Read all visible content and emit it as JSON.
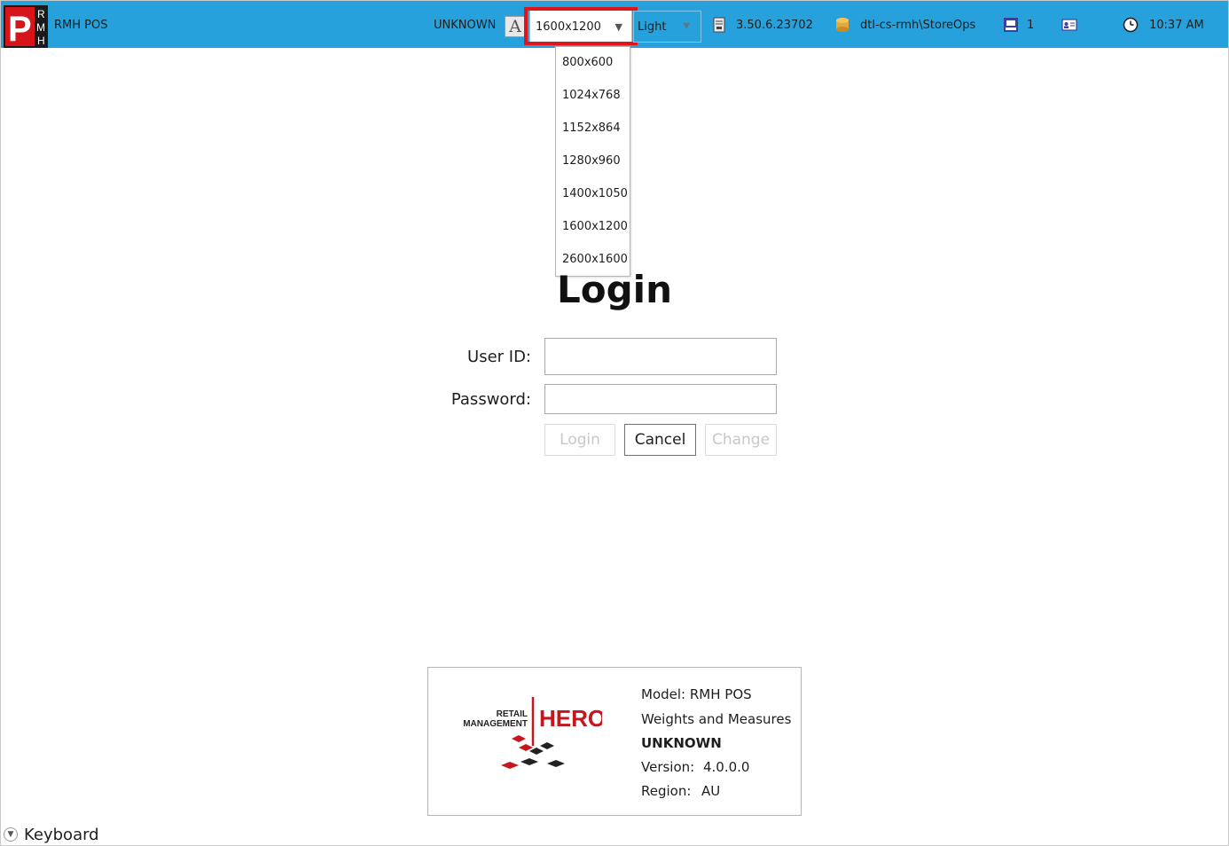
{
  "app": {
    "logo_letters": [
      "P",
      "R",
      "M",
      "H"
    ],
    "title": "RMH POS"
  },
  "topbar": {
    "user": "UNKNOWN",
    "font_icon": "A",
    "resolution_selected": "1600x1200",
    "theme_selected": "Light",
    "version": "3.50.6.23702",
    "database": "dtl-cs-rmh\\StoreOps",
    "register_count": "1",
    "time": "10:37 AM",
    "highlight_color": "#e0151b",
    "bar_color": "#27a1dc"
  },
  "resolution_options": [
    "800x600",
    "1024x768",
    "1152x864",
    "1280x960",
    "1400x1050",
    "1600x1200",
    "2600x1600"
  ],
  "login": {
    "title": "Login",
    "user_id_label": "User ID:",
    "password_label": "Password:",
    "user_id_value": "",
    "password_value": "",
    "login_button": "Login",
    "cancel_button": "Cancel",
    "change_button": "Change"
  },
  "info": {
    "logo_retail": "RETAIL",
    "logo_management": "MANAGEMENT",
    "logo_hero": "HERO",
    "model": "Model: RMH POS",
    "weights": "Weights and Measures",
    "status": "UNKNOWN",
    "version_label": "Version:",
    "version_value": "4.0.0.0",
    "region_label": "Region:",
    "region_value": "AU"
  },
  "keyboard": {
    "label": "Keyboard"
  }
}
